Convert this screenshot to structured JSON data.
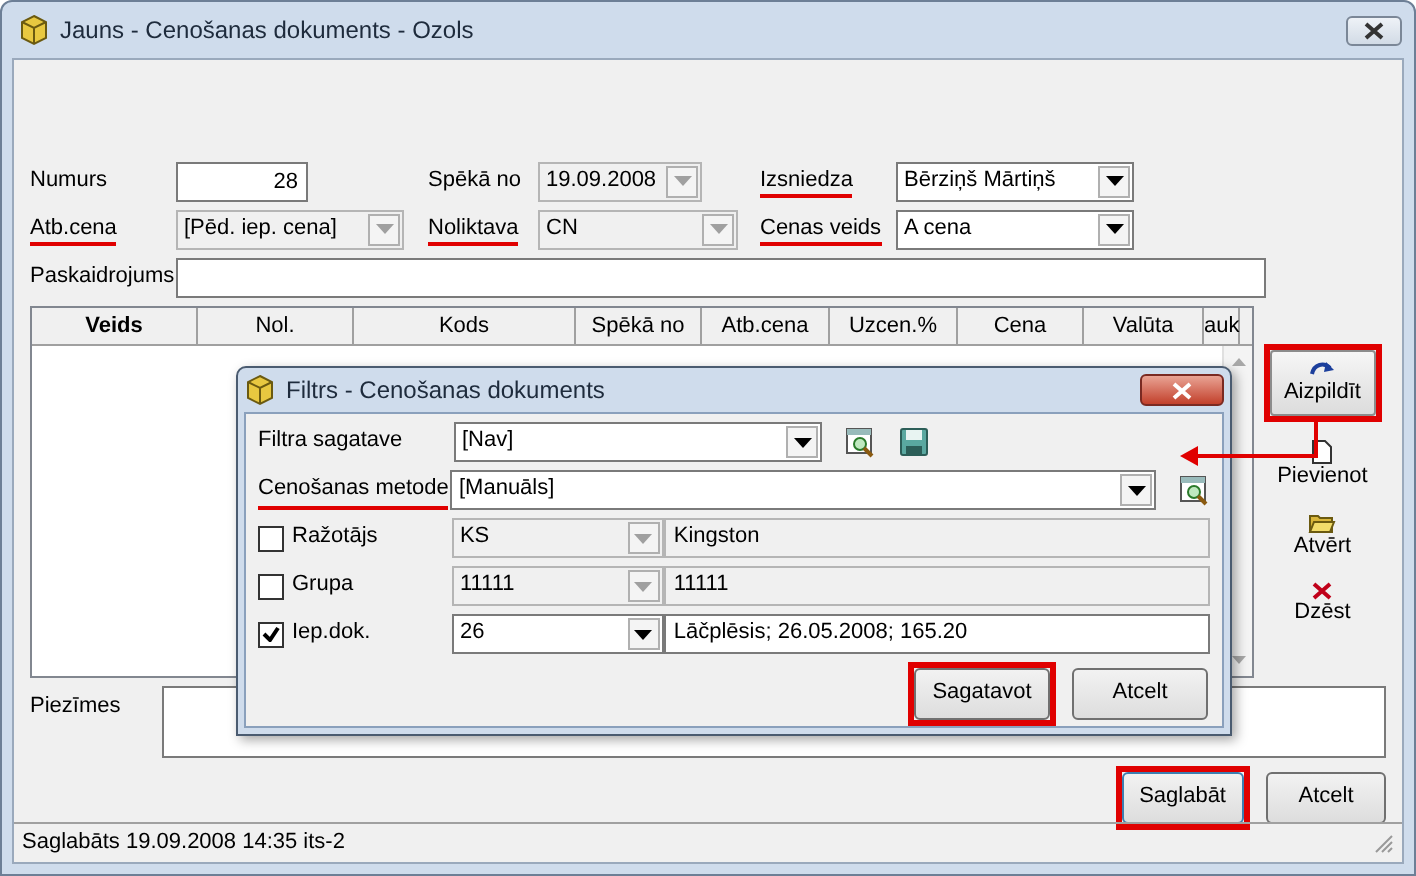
{
  "window": {
    "title": "Jauns - Cenošanas dokuments - Ozols"
  },
  "form_rows": [
    [
      {
        "label": "Numurs",
        "kind": "text",
        "value": "28",
        "annotated": false
      },
      {
        "label": "Spēkā no",
        "kind": "combo",
        "value": "19.09.2008",
        "disabled": true,
        "annotated": false
      },
      {
        "label": "Izsniedza",
        "kind": "combo",
        "value": "Bērziņš Mārtiņš",
        "disabled": false,
        "annotated": true
      }
    ],
    [
      {
        "label": "Atb.cena",
        "kind": "combo",
        "value": "[Pēd. iep. cena]",
        "disabled": true,
        "annotated": true
      },
      {
        "label": "Noliktava",
        "kind": "combo",
        "value": "CN",
        "disabled": true,
        "annotated": true
      },
      {
        "label": "Cenas veids",
        "kind": "combo",
        "value": "A cena",
        "disabled": false,
        "annotated": true
      }
    ],
    [
      {
        "label": "Paskaidrojums",
        "kind": "text",
        "annotated": false
      }
    ]
  ],
  "table": {
    "columns": [
      "Veids",
      "Nol.",
      "Kods",
      "Spēkā no",
      "Atb.cena",
      "Uzcen.%",
      "Cena",
      "Valūta",
      "auk"
    ]
  },
  "side_buttons": [
    {
      "label": "Aizpildīt",
      "kind": "fill",
      "annotated": true
    },
    {
      "label": "Pievienot",
      "kind": "new",
      "annotated": false
    },
    {
      "label": "Atvērt",
      "kind": "open",
      "annotated": false
    },
    {
      "label": "Dzēst",
      "kind": "delete",
      "annotated": false
    }
  ],
  "annotation_arrow": true,
  "notes": {
    "label": "Piezīmes"
  },
  "buttons": [
    {
      "label": "Saglabāt",
      "annotated": true
    },
    {
      "label": "Atcelt",
      "annotated": false
    }
  ],
  "status_bar": "Saglabāts 19.09.2008 14:35 its-2",
  "dialog": {
    "title": "Filtrs - Cenošanas dokuments",
    "rows": [
      {
        "kind": "template",
        "label": "Filtra sagatave",
        "value": "[Nav]",
        "annotated": false
      },
      {
        "kind": "method",
        "label": "Cenošanas metode",
        "value": "[Manuāls]",
        "annotated": true
      },
      {
        "kind": "filter",
        "label": "Ražotājs",
        "checked": false,
        "code": "KS",
        "name": "Kingston"
      },
      {
        "kind": "filter",
        "label": "Grupa",
        "checked": false,
        "code": "11111",
        "name": "11111"
      },
      {
        "kind": "filter",
        "label": "Iep.dok.",
        "checked": true,
        "code": "26",
        "name": "Lāčplēsis; 26.05.2008; 165.20"
      }
    ],
    "buttons": [
      {
        "label": "Sagatavot",
        "annotated": true
      },
      {
        "label": "Atcelt",
        "annotated": false
      }
    ]
  }
}
